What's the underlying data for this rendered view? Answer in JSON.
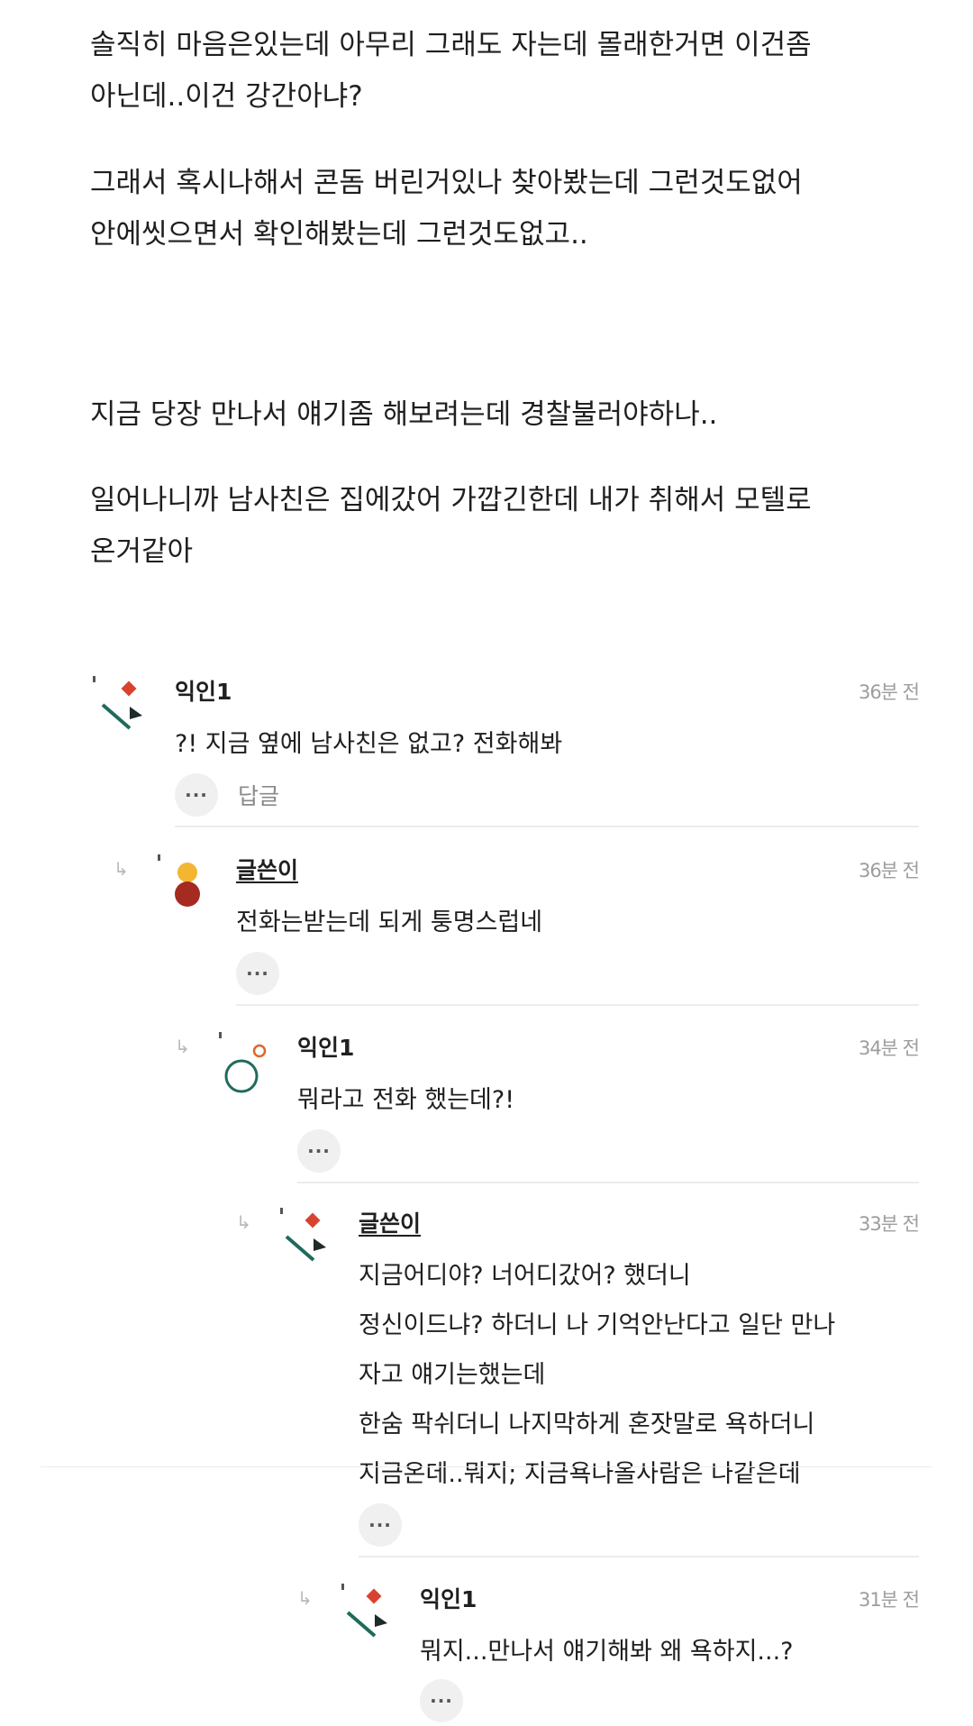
{
  "post": {
    "paragraphs": [
      [
        "솔직히 마음은있는데 아무리 그래도 자는데 몰래한거면 이건좀",
        "아닌데..이건 강간아냐?"
      ],
      [
        "그래서 혹시나해서 콘돔 버린거있나 찾아봤는데 그런것도없어",
        "안에씻으면서 확인해봤는데 그런것도없고.."
      ],
      [
        "지금 당장 만나서 얘기좀 해보려는데 경찰불러야하나.."
      ],
      [
        "일어나니까 남사친은 집에갔어 가깝긴한데 내가 취해서 모텔로",
        "온거같아"
      ]
    ]
  },
  "comments": [
    {
      "nickname": "익인1",
      "time": "36분 전",
      "lines": [
        "?! 지금 옆에 남사친은 없고? 전화해봐"
      ],
      "more_label": "···",
      "reply_label": "답글",
      "avatar_icon": "diamond-slash-avatar-icon"
    },
    {
      "nickname": "글쓴이",
      "time": "36분 전",
      "lines": [
        "전화는받는데 되게 퉁명스럽네"
      ],
      "more_label": "···",
      "avatar_icon": "circles-avatar-icon"
    },
    {
      "nickname": "익인1",
      "time": "34분 전",
      "lines": [
        "뭐라고 전화 했는데?!"
      ],
      "more_label": "···",
      "avatar_icon": "ring-avatar-icon"
    },
    {
      "nickname": "글쓴이",
      "time": "33분 전",
      "lines": [
        "지금어디야? 너어디갔어? 했더니",
        "정신이드냐? 하더니 나 기억안난다고 일단 만나",
        "자고 얘기는했는데",
        "한숨 팍쉬더니 나지막하게 혼잣말로 욕하더니",
        "지금온데..뭐지; 지금욕나올사람은 나같은데"
      ],
      "more_label": "···",
      "avatar_icon": "diamond-slash-avatar-icon"
    },
    {
      "nickname": "익인1",
      "time": "31분 전",
      "lines": [
        "뭐지...만나서 얘기해봐 왜 욕하지...?"
      ],
      "more_label": "···",
      "avatar_icon": "diamond-slash-avatar-icon"
    }
  ],
  "reply_arrow_glyph": "↳",
  "colors": {
    "avatar_red": "#d9422f",
    "avatar_teal": "#1f6b5c",
    "avatar_yellow": "#f2b632",
    "avatar_darkred": "#a52a1f",
    "avatar_orange": "#d9692b"
  }
}
